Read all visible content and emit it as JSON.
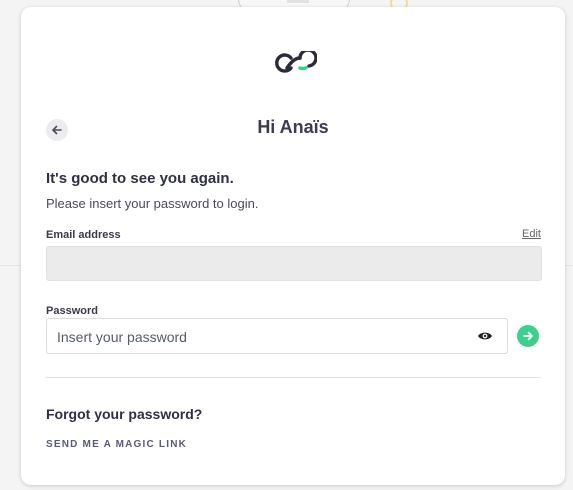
{
  "header": {
    "greeting": "Hi Anaïs"
  },
  "intro": {
    "headline": "It's good to see you again.",
    "subtext": "Please insert your password to login."
  },
  "email": {
    "label": "Email address",
    "edit_label": "Edit",
    "value": ""
  },
  "password": {
    "label": "Password",
    "placeholder": "Insert your password"
  },
  "forgot": {
    "title": "Forgot your password?",
    "magic_link_label": "SEND ME A MAGIC LINK"
  },
  "colors": {
    "accent": "#3ccf8e",
    "logo": "#2b2b3a"
  },
  "icons": {
    "logo": "infinity-logo-icon",
    "back": "arrow-left-icon",
    "eye": "eye-icon",
    "submit": "arrow-right-icon"
  }
}
